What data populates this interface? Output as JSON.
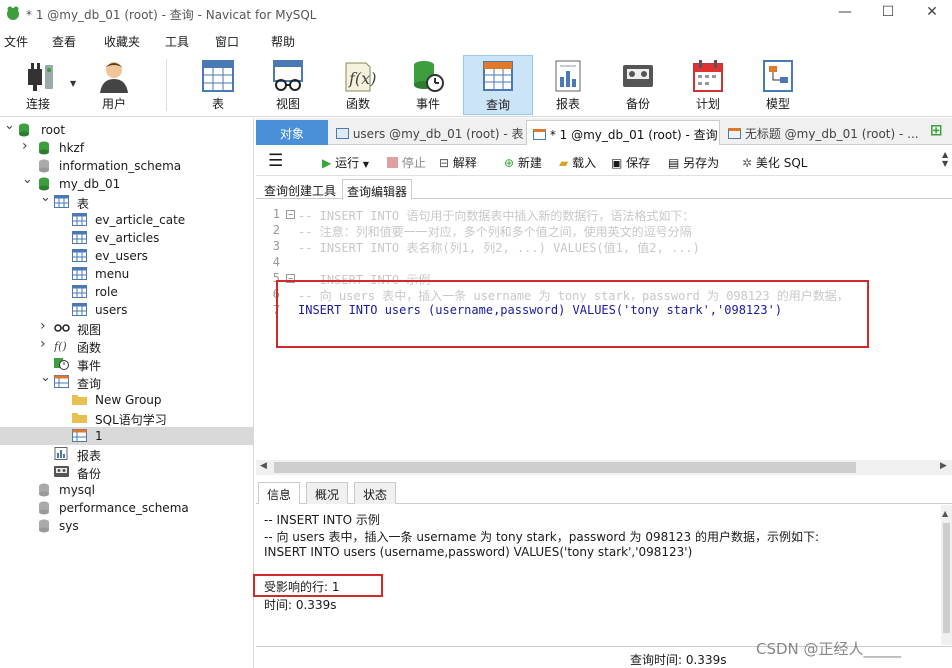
{
  "window": {
    "title": "* 1 @my_db_01 (root) - 查询 - Navicat for MySQL",
    "minimize": "—",
    "maximize": "☐",
    "close": "✕"
  },
  "menu": [
    "文件",
    "查看",
    "收藏夹",
    "工具",
    "窗口",
    "帮助"
  ],
  "toolbar": [
    {
      "label": "连接",
      "icon": "plug-icon"
    },
    {
      "label": "用户",
      "icon": "user-icon"
    },
    {
      "label": "表",
      "icon": "table-icon"
    },
    {
      "label": "视图",
      "icon": "view-icon"
    },
    {
      "label": "函数",
      "icon": "function-icon"
    },
    {
      "label": "事件",
      "icon": "event-icon"
    },
    {
      "label": "查询",
      "icon": "query-icon"
    },
    {
      "label": "报表",
      "icon": "report-icon"
    },
    {
      "label": "备份",
      "icon": "backup-icon"
    },
    {
      "label": "计划",
      "icon": "schedule-icon"
    },
    {
      "label": "模型",
      "icon": "model-icon"
    }
  ],
  "tree": [
    {
      "label": "root",
      "level": 0,
      "arrow": "◢",
      "icon": "db-green"
    },
    {
      "label": "hkzf",
      "level": 1,
      "arrow": "›",
      "icon": "db-green"
    },
    {
      "label": "information_schema",
      "level": 1,
      "arrow": "",
      "icon": "db-gray"
    },
    {
      "label": "my_db_01",
      "level": 1,
      "arrow": "◢",
      "icon": "db-green"
    },
    {
      "label": "表",
      "level": 2,
      "arrow": "◢",
      "icon": "table"
    },
    {
      "label": "ev_article_cate",
      "level": 3,
      "arrow": "",
      "icon": "table"
    },
    {
      "label": "ev_articles",
      "level": 3,
      "arrow": "",
      "icon": "table"
    },
    {
      "label": "ev_users",
      "level": 3,
      "arrow": "",
      "icon": "table"
    },
    {
      "label": "menu",
      "level": 3,
      "arrow": "",
      "icon": "table"
    },
    {
      "label": "role",
      "level": 3,
      "arrow": "",
      "icon": "table"
    },
    {
      "label": "users",
      "level": 3,
      "arrow": "",
      "icon": "table"
    },
    {
      "label": "视图",
      "level": 2,
      "arrow": "›",
      "icon": "view"
    },
    {
      "label": "函数",
      "level": 2,
      "arrow": "›",
      "icon": "func"
    },
    {
      "label": "事件",
      "level": 2,
      "arrow": "",
      "icon": "event"
    },
    {
      "label": "查询",
      "level": 2,
      "arrow": "◢",
      "icon": "query"
    },
    {
      "label": "New Group",
      "level": 3,
      "arrow": "",
      "icon": "folder"
    },
    {
      "label": "SQL语句学习",
      "level": 3,
      "arrow": "",
      "icon": "folder"
    },
    {
      "label": "1",
      "level": 3,
      "arrow": "",
      "icon": "query",
      "selected": true
    },
    {
      "label": "报表",
      "level": 2,
      "arrow": "",
      "icon": "report"
    },
    {
      "label": "备份",
      "level": 2,
      "arrow": "",
      "icon": "backup"
    },
    {
      "label": "mysql",
      "level": 1,
      "arrow": "",
      "icon": "db-gray"
    },
    {
      "label": "performance_schema",
      "level": 1,
      "arrow": "",
      "icon": "db-gray"
    },
    {
      "label": "sys",
      "level": 1,
      "arrow": "",
      "icon": "db-gray"
    }
  ],
  "tabs": {
    "objects": "对象",
    "t1": "users @my_db_01 (root) - 表",
    "t2": "* 1 @my_db_01 (root) - 查询",
    "t3": "无标题 @my_db_01 (root) - ..."
  },
  "query_toolbar": {
    "run": "运行",
    "stop": "停止",
    "explain": "解释",
    "new": "新建",
    "load": "载入",
    "save": "保存",
    "save_as": "另存为",
    "beautify": "美化 SQL"
  },
  "subtabs": {
    "builder": "查询创建工具",
    "editor": "查询编辑器"
  },
  "editor": {
    "lines": [
      {
        "n": "1",
        "text": "-- INSERT INTO 语句用于向数据表中插入新的数据行，语法格式如下：",
        "cls": "cm"
      },
      {
        "n": "2",
        "text": "-- 注意：列和值要一一对应，多个列和多个值之间，使用英文的逗号分隔",
        "cls": "cm"
      },
      {
        "n": "3",
        "text": "-- INSERT INTO 表名称(列1, 列2, ...) VALUES(值1, 值2, ...)",
        "cls": "cm"
      },
      {
        "n": "4",
        "text": "",
        "cls": "cm"
      },
      {
        "n": "5",
        "text": "-- INSERT INTO 示例",
        "cls": "cm"
      },
      {
        "n": "6",
        "text": "-- 向 users 表中，插入一条 username 为 tony stark，password 为 098123 的用户数据，",
        "cls": "cm"
      },
      {
        "n": "7",
        "text": "INSERT INTO users (username,password) VALUES('tony stark','098123')",
        "cls": "sql"
      }
    ]
  },
  "bottom_tabs": {
    "info": "信息",
    "profile": "概况",
    "status": "状态"
  },
  "info": {
    "l1": "-- INSERT INTO 示例",
    "l2": "-- 向 users 表中，插入一条 username 为 tony stark，password 为 098123 的用户数据，示例如下:",
    "l3": "INSERT INTO users (username,password) VALUES('tony stark','098123')",
    "affected": "受影响的行: 1",
    "time": "时间: 0.339s"
  },
  "status": {
    "query_time": "查询时间: 0.339s"
  },
  "watermark": "CSDN @正经人_____"
}
